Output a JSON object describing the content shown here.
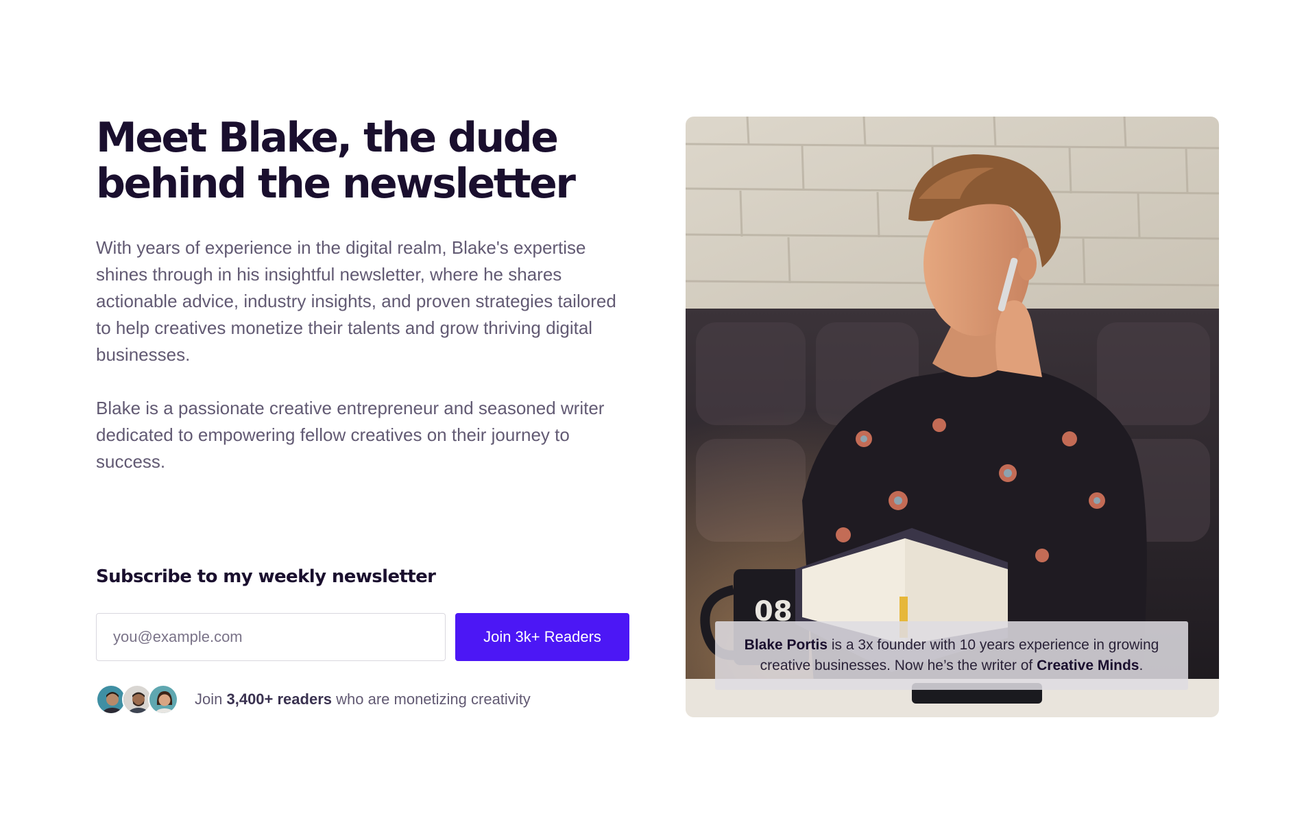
{
  "headline": {
    "line1": "Meet Blake, the dude",
    "line2": "behind the newsletter"
  },
  "bio": {
    "paragraph1": " With years of experience in the digital realm, Blake's expertise shines through in his insightful newsletter, where he shares actionable advice, industry insights, and proven strategies tailored to help creatives monetize their talents and grow thriving digital businesses.",
    "paragraph2": "Blake is a passionate creative entrepreneur and seasoned writer dedicated to empowering fellow creatives on their journey to success."
  },
  "subscribe": {
    "title": "Subscribe to my weekly newsletter",
    "email_placeholder": "you@example.com",
    "email_value": "",
    "button_label": "Join 3k+ Readers"
  },
  "social_proof": {
    "prefix": "Join ",
    "highlight": "3,400+ readers",
    "suffix": " who are monetizing creativity"
  },
  "photo": {
    "caption_name": "Blake Portis",
    "caption_middle": " is a 3x founder with 10 years experience in growing creative businesses. Now he’s the writer of ",
    "caption_publication": "Creative Minds",
    "caption_end": ".",
    "mug_text": "08"
  },
  "colors": {
    "heading": "#1a0f2e",
    "body_text": "#625a73",
    "accent_button": "#4c17f5",
    "input_border": "#d9d7de"
  }
}
